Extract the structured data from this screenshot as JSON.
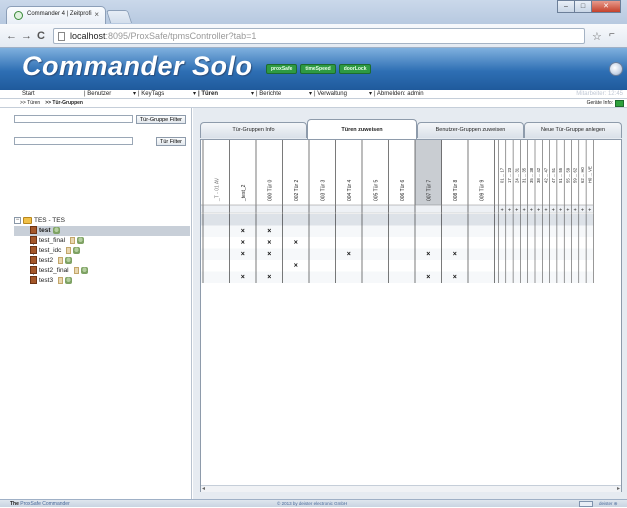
{
  "browser": {
    "tab_title": "Commander 4 | Zeitprofi",
    "tab_close": "×",
    "url_host": "localhost",
    "url_rest": ":8095/ProxSafe/tpmsController?tab=1",
    "back": "←",
    "forward": "→",
    "reload": "C",
    "star": "☆",
    "wrench": "⌐",
    "min": "–",
    "max": "□",
    "close": "✕"
  },
  "banner": {
    "app_title": "Commander Solo",
    "badges": [
      "proxSafe",
      "timeSpeed",
      "doorLock"
    ]
  },
  "menu": {
    "items": [
      {
        "label": "Start",
        "dropdown": false
      },
      {
        "label": "| Benutzer",
        "dropdown": true
      },
      {
        "label": "| KeyTags",
        "dropdown": true
      },
      {
        "label": "| Türen",
        "dropdown": true,
        "active": true
      },
      {
        "label": "| Berichte",
        "dropdown": true
      },
      {
        "label": "| Verwaltung",
        "dropdown": true
      },
      {
        "label": "| Abmelden: admin",
        "dropdown": false
      }
    ],
    "dropdown_arrow": "▾",
    "mitarbeiter": "Mitarbeiter: 12:45"
  },
  "breadcrumb": {
    "first": ">> Türen",
    "second": ">> Tür-Gruppen",
    "geraete_label": "Geräte Info:"
  },
  "filters": {
    "group_filter_btn": "Tür-Gruppe Filter",
    "door_filter_btn": "Tür Filter",
    "group_filter_value": "",
    "door_filter_value": ""
  },
  "tree": {
    "expander": "−",
    "root": "TES - TES",
    "children": [
      {
        "label": "test",
        "selected": true,
        "doc": false
      },
      {
        "label": "test_final",
        "selected": false,
        "doc": true
      },
      {
        "label": "test_idc",
        "selected": false,
        "doc": true
      },
      {
        "label": "test2",
        "selected": false,
        "doc": true
      },
      {
        "label": "test2_final",
        "selected": false,
        "doc": true
      },
      {
        "label": "test3",
        "selected": false,
        "doc": true
      }
    ]
  },
  "tabs": [
    "Tür-Gruppen Info",
    "Türen zuweisen",
    "Benutzer-Gruppen zuweisen",
    "Neue Tür-Gruppe anlegen"
  ],
  "active_tab": 1,
  "grid": {
    "columns": [
      {
        "label": "_T - 01 AV",
        "dim": true
      },
      {
        "label": "_test_2",
        "dim": false
      },
      {
        "label": "000 Tür 0",
        "dim": false
      },
      {
        "label": "002 Tür 2",
        "dim": false
      },
      {
        "label": "003 Tür 3",
        "dim": false
      },
      {
        "label": "004 Tür 4",
        "dim": false
      },
      {
        "label": "005 Tür 5",
        "dim": false
      },
      {
        "label": "006 Tür 6",
        "dim": false
      },
      {
        "label": "007 Tür 7",
        "dim": false,
        "highlight": true
      },
      {
        "label": "008 Tür 8",
        "dim": false
      },
      {
        "label": "009 Tür 9",
        "dim": false
      }
    ],
    "narrow_columns": [
      "01 ... 17",
      "17 ... 23",
      "24 ... 31",
      "31 ... 35",
      "35 ... 38",
      "38 ... 42",
      "42 ... 47",
      "47 ... 51",
      "51 ... 55",
      "55 ... 59",
      "59 ... 62",
      "62 ... H0",
      "H0 ... VE"
    ],
    "plus": "+",
    "mark": "×",
    "rows": [
      [
        0,
        0,
        0,
        0,
        0,
        0,
        0,
        0,
        0,
        0,
        0
      ],
      [
        0,
        1,
        1,
        0,
        0,
        0,
        0,
        0,
        0,
        0,
        0
      ],
      [
        0,
        1,
        1,
        1,
        0,
        0,
        0,
        0,
        0,
        0,
        0
      ],
      [
        0,
        1,
        1,
        0,
        0,
        1,
        0,
        0,
        1,
        1,
        0
      ],
      [
        0,
        0,
        0,
        1,
        0,
        0,
        0,
        0,
        0,
        0,
        0
      ],
      [
        0,
        1,
        1,
        0,
        0,
        0,
        0,
        0,
        1,
        1,
        0
      ]
    ]
  },
  "scroll": {
    "left": "◂",
    "right": "▸"
  },
  "status": {
    "left_bold": "The",
    "left_rest": " ProxSafe Commander",
    "mid": "© 2013 by deister electronic GmbH",
    "right": "deister ⊛"
  },
  "colors": {
    "banner": "#2e6fb4",
    "badge": "#2e9a43",
    "selected_row": "#c8cfd8",
    "highlight_col": "#c9cdd2"
  }
}
